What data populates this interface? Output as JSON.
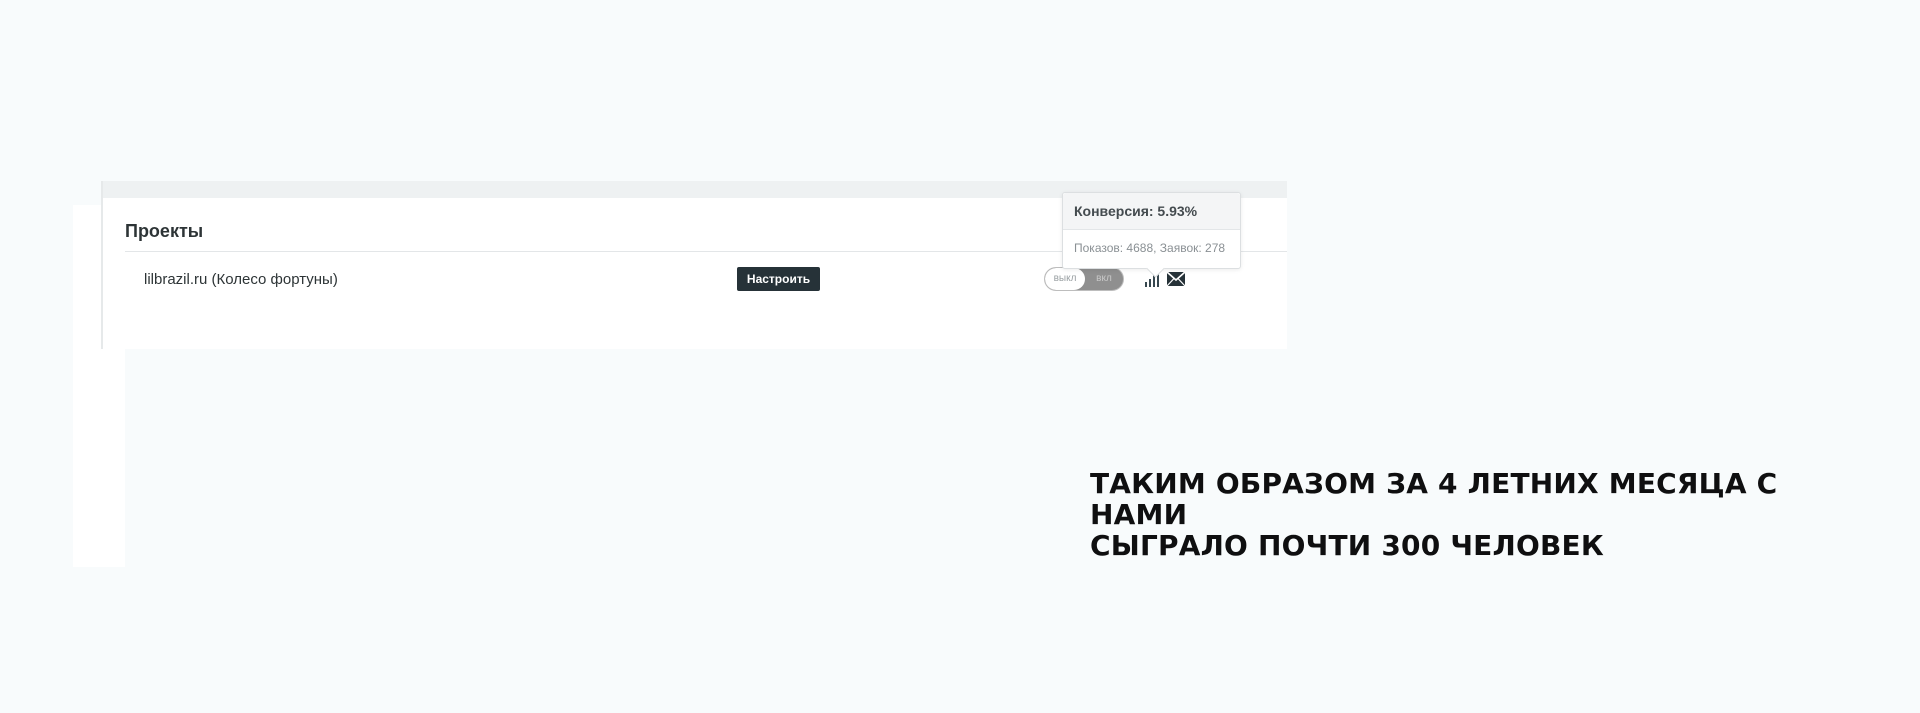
{
  "panel": {
    "title": "Проекты",
    "project": {
      "name": "lilbrazil.ru (Колесо фортуны)",
      "configure_label": "Настроить",
      "toggle": {
        "off_label": "выкл",
        "on_label": "вкл",
        "state": "off"
      }
    },
    "icons": {
      "stats": "bar-chart-icon",
      "mail": "envelope-icon"
    }
  },
  "tooltip": {
    "title": "Конверсия: 5.93%",
    "body": "Показов: 4688, Заявок: 278"
  },
  "caption": {
    "line1": "ТАКИМ ОБРАЗОМ ЗА 4 ЛЕТНИХ МЕСЯЦА С НАМИ",
    "line2": "СЫГРАЛО ПОЧТИ 300 ЧЕЛОВЕК"
  },
  "colors": {
    "background": "#f8fbfc",
    "button": "#263238",
    "toggle_track": "#8f8f8f",
    "caption_text": "#0f0f10"
  }
}
